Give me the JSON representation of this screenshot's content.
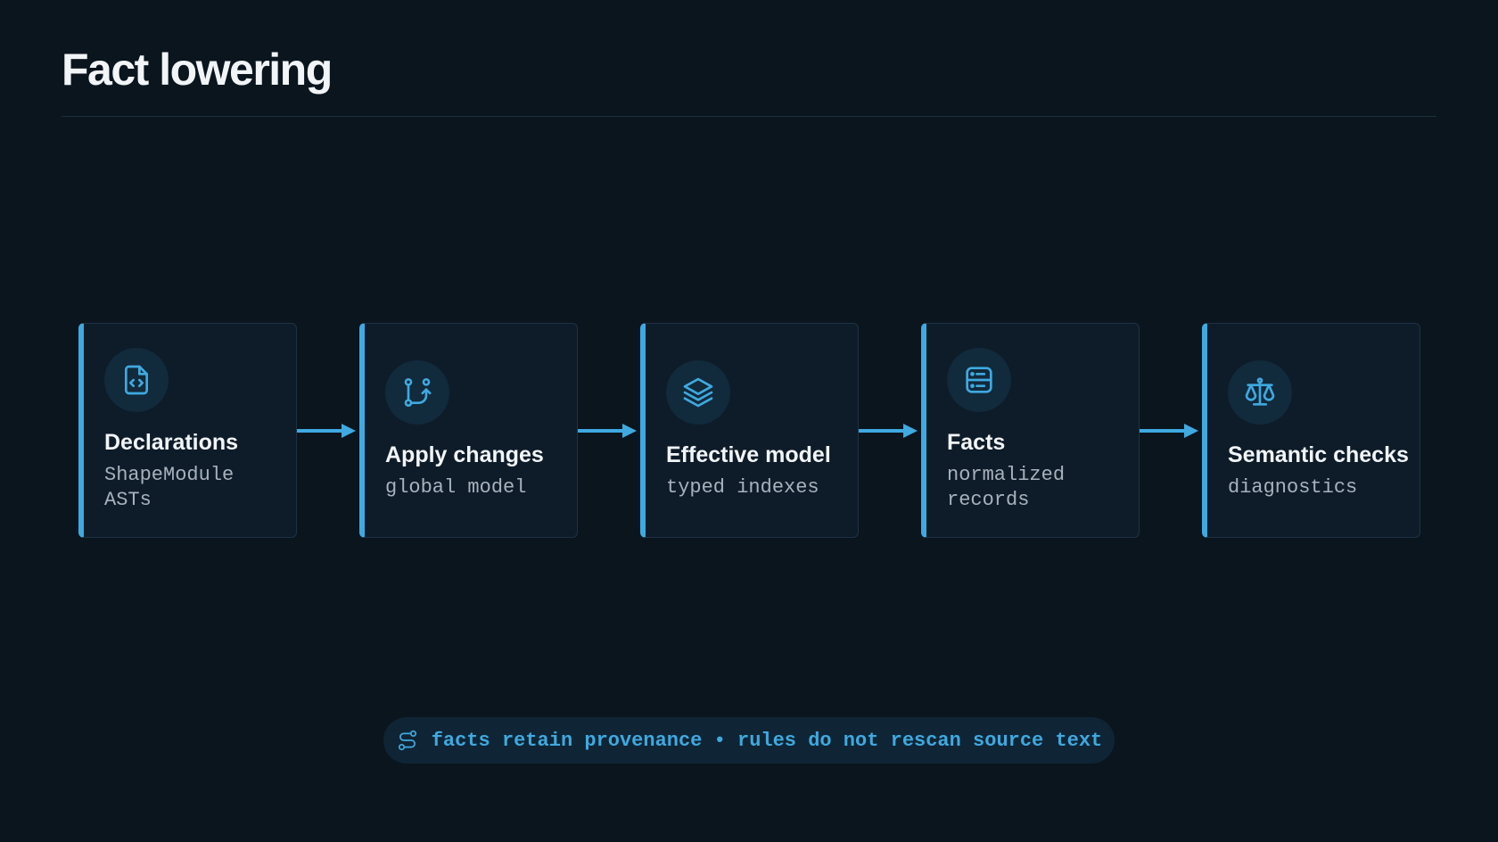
{
  "title": "Fact lowering",
  "accent_color": "#3fa9e0",
  "stages": [
    {
      "icon": "file-code-icon",
      "title": "Declarations",
      "subtitle": "ShapeModule ASTs"
    },
    {
      "icon": "git-branch-icon",
      "title": "Apply changes",
      "subtitle": "global model"
    },
    {
      "icon": "layers-icon",
      "title": "Effective model",
      "subtitle": "typed indexes"
    },
    {
      "icon": "database-records-icon",
      "title": "Facts",
      "subtitle": "normalized records"
    },
    {
      "icon": "scale-icon",
      "title": "Semantic checks",
      "subtitle": "diagnostics"
    }
  ],
  "footer": {
    "icon": "route-icon",
    "text": "facts retain provenance • rules do not rescan source text"
  }
}
